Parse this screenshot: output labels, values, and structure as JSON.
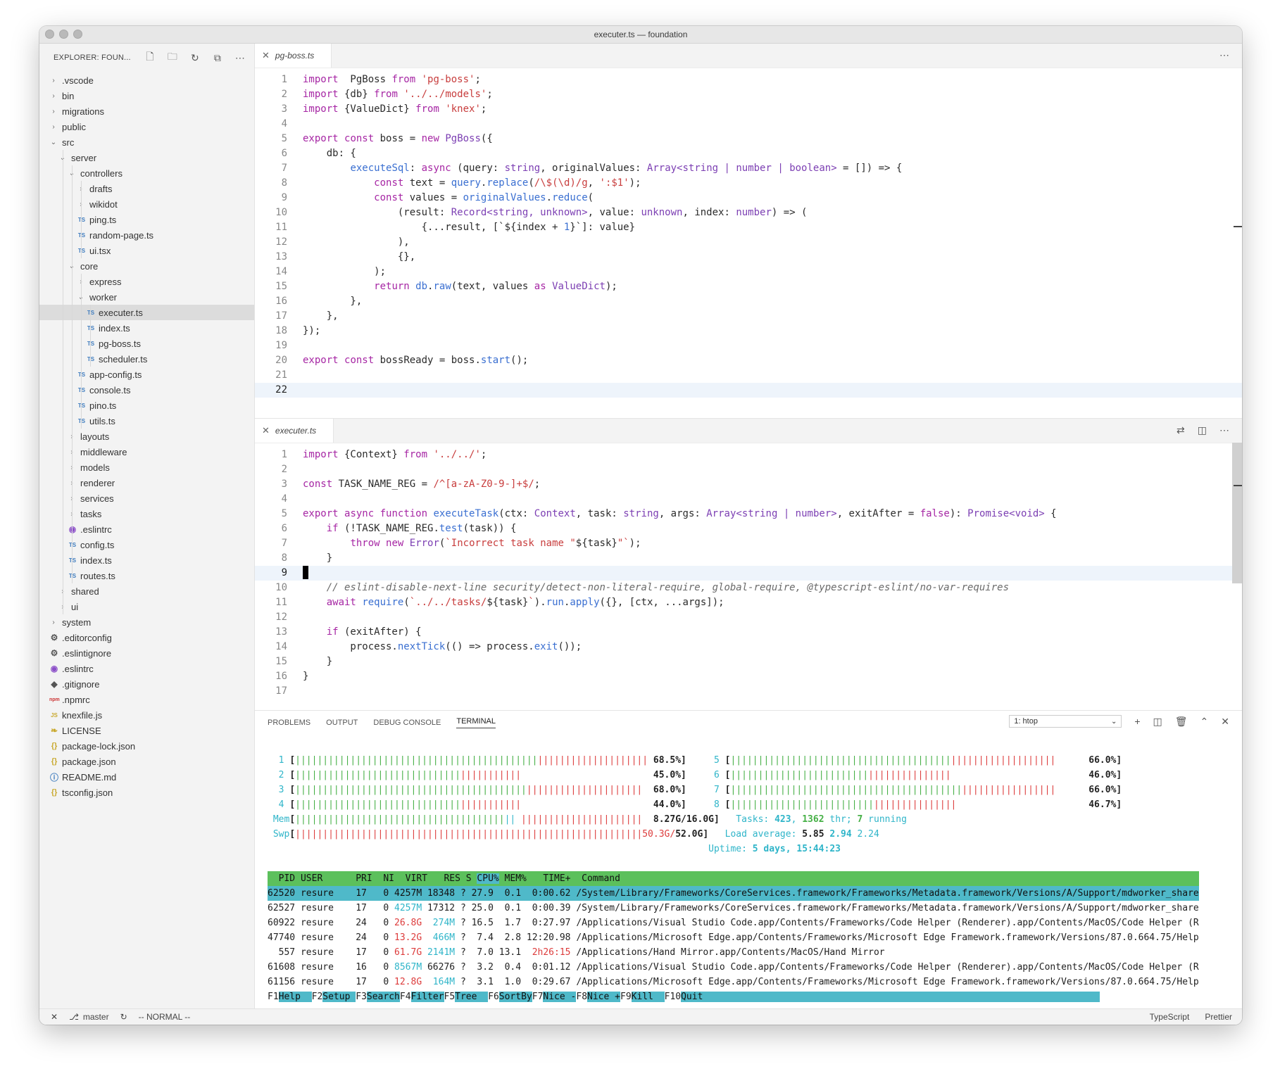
{
  "window": {
    "title": "executer.ts — foundation"
  },
  "sidebar": {
    "title": "EXPLORER: FOUN...",
    "actions": [
      "new-file-icon",
      "new-folder-icon",
      "refresh-icon",
      "collapse-icon",
      "more-icon"
    ],
    "tree": [
      {
        "d": 0,
        "t": "folder",
        "label": ".vscode",
        "open": false
      },
      {
        "d": 0,
        "t": "folder",
        "label": "bin",
        "open": false
      },
      {
        "d": 0,
        "t": "folder",
        "label": "migrations",
        "open": false
      },
      {
        "d": 0,
        "t": "folder",
        "label": "public",
        "open": false
      },
      {
        "d": 0,
        "t": "folder",
        "label": "src",
        "open": true
      },
      {
        "d": 1,
        "t": "folder",
        "label": "server",
        "open": true
      },
      {
        "d": 2,
        "t": "folder",
        "label": "controllers",
        "open": true
      },
      {
        "d": 3,
        "t": "folder",
        "label": "drafts",
        "open": false
      },
      {
        "d": 3,
        "t": "folder",
        "label": "wikidot",
        "open": false
      },
      {
        "d": 3,
        "t": "ts",
        "label": "ping.ts"
      },
      {
        "d": 3,
        "t": "ts",
        "label": "random-page.ts"
      },
      {
        "d": 3,
        "t": "ts",
        "label": "ui.tsx"
      },
      {
        "d": 2,
        "t": "folder",
        "label": "core",
        "open": true
      },
      {
        "d": 3,
        "t": "folder",
        "label": "express",
        "open": false
      },
      {
        "d": 3,
        "t": "folder",
        "label": "worker",
        "open": true
      },
      {
        "d": 4,
        "t": "ts",
        "label": "executer.ts",
        "selected": true
      },
      {
        "d": 4,
        "t": "ts",
        "label": "index.ts"
      },
      {
        "d": 4,
        "t": "ts",
        "label": "pg-boss.ts"
      },
      {
        "d": 4,
        "t": "ts",
        "label": "scheduler.ts"
      },
      {
        "d": 3,
        "t": "ts",
        "label": "app-config.ts"
      },
      {
        "d": 3,
        "t": "ts",
        "label": "console.ts"
      },
      {
        "d": 3,
        "t": "ts",
        "label": "pino.ts"
      },
      {
        "d": 3,
        "t": "ts",
        "label": "utils.ts"
      },
      {
        "d": 2,
        "t": "folder",
        "label": "layouts",
        "open": false
      },
      {
        "d": 2,
        "t": "folder",
        "label": "middleware",
        "open": false
      },
      {
        "d": 2,
        "t": "folder",
        "label": "models",
        "open": false
      },
      {
        "d": 2,
        "t": "folder",
        "label": "renderer",
        "open": false
      },
      {
        "d": 2,
        "t": "folder",
        "label": "services",
        "open": false
      },
      {
        "d": 2,
        "t": "folder",
        "label": "tasks",
        "open": false
      },
      {
        "d": 2,
        "t": "eslint",
        "label": ".eslintrc"
      },
      {
        "d": 2,
        "t": "ts",
        "label": "config.ts"
      },
      {
        "d": 2,
        "t": "ts",
        "label": "index.ts"
      },
      {
        "d": 2,
        "t": "ts",
        "label": "routes.ts"
      },
      {
        "d": 1,
        "t": "folder",
        "label": "shared",
        "open": false
      },
      {
        "d": 1,
        "t": "folder",
        "label": "ui",
        "open": false
      },
      {
        "d": 0,
        "t": "folder",
        "label": "system",
        "open": false
      },
      {
        "d": 0,
        "t": "gear",
        "label": ".editorconfig"
      },
      {
        "d": 0,
        "t": "gear",
        "label": ".eslintignore"
      },
      {
        "d": 0,
        "t": "eslint",
        "label": ".eslintrc"
      },
      {
        "d": 0,
        "t": "git",
        "label": ".gitignore"
      },
      {
        "d": 0,
        "t": "npm",
        "label": ".npmrc"
      },
      {
        "d": 0,
        "t": "js",
        "label": "knexfile.js"
      },
      {
        "d": 0,
        "t": "license",
        "label": "LICENSE"
      },
      {
        "d": 0,
        "t": "json",
        "label": "package-lock.json"
      },
      {
        "d": 0,
        "t": "json",
        "label": "package.json"
      },
      {
        "d": 0,
        "t": "info",
        "label": "README.md"
      },
      {
        "d": 0,
        "t": "json",
        "label": "tsconfig.json"
      }
    ]
  },
  "editor_top": {
    "tab": "pg-boss.ts",
    "current_line": 22,
    "lines": [
      [
        [
          "kw",
          "import"
        ],
        [
          "",
          "  PgBoss "
        ],
        [
          "kw",
          "from"
        ],
        [
          "",
          " "
        ],
        [
          "str",
          "'pg-boss'"
        ],
        [
          "",
          ";"
        ]
      ],
      [
        [
          "kw",
          "import"
        ],
        [
          "",
          " {db} "
        ],
        [
          "kw",
          "from"
        ],
        [
          "",
          " "
        ],
        [
          "str",
          "'../../models'"
        ],
        [
          "",
          ";"
        ]
      ],
      [
        [
          "kw",
          "import"
        ],
        [
          "",
          " {ValueDict} "
        ],
        [
          "kw",
          "from"
        ],
        [
          "",
          " "
        ],
        [
          "str",
          "'knex'"
        ],
        [
          "",
          ";"
        ]
      ],
      [],
      [
        [
          "kw",
          "export"
        ],
        [
          "",
          " "
        ],
        [
          "kw",
          "const"
        ],
        [
          "",
          " boss = "
        ],
        [
          "kw",
          "new"
        ],
        [
          "",
          " "
        ],
        [
          "ty",
          "PgBoss"
        ],
        [
          "",
          "({"
        ]
      ],
      [
        [
          "",
          "    db: {"
        ]
      ],
      [
        [
          "",
          "        "
        ],
        [
          "fn",
          "executeSql"
        ],
        [
          "",
          ": "
        ],
        [
          "kw",
          "async"
        ],
        [
          "",
          " (query: "
        ],
        [
          "ty",
          "string"
        ],
        [
          "",
          ", originalValues: "
        ],
        [
          "ty",
          "Array<string | number | boolean>"
        ],
        [
          "",
          " = []) => {"
        ]
      ],
      [
        [
          "",
          "            "
        ],
        [
          "kw",
          "const"
        ],
        [
          "",
          " text = "
        ],
        [
          "fn",
          "query"
        ],
        [
          "",
          "."
        ],
        [
          "fn",
          "replace"
        ],
        [
          "",
          "("
        ],
        [
          "str",
          "/\\$(\\d)/g"
        ],
        [
          "",
          ", "
        ],
        [
          "str",
          "':$1'"
        ],
        [
          "",
          ");"
        ]
      ],
      [
        [
          "",
          "            "
        ],
        [
          "kw",
          "const"
        ],
        [
          "",
          " values = "
        ],
        [
          "fn",
          "originalValues"
        ],
        [
          "",
          "."
        ],
        [
          "fn",
          "reduce"
        ],
        [
          "",
          "("
        ]
      ],
      [
        [
          "",
          "                (result: "
        ],
        [
          "ty",
          "Record<string, unknown>"
        ],
        [
          "",
          ", value: "
        ],
        [
          "ty",
          "unknown"
        ],
        [
          "",
          ", index: "
        ],
        [
          "ty",
          "number"
        ],
        [
          "",
          ") => ("
        ]
      ],
      [
        [
          "",
          "                    {...result, [`${index + "
        ],
        [
          "num",
          "1"
        ],
        [
          "",
          "}`]: value}"
        ]
      ],
      [
        [
          "",
          "                ),"
        ]
      ],
      [
        [
          "",
          "                {},"
        ]
      ],
      [
        [
          "",
          "            );"
        ]
      ],
      [
        [
          "",
          "            "
        ],
        [
          "kw",
          "return"
        ],
        [
          "",
          " "
        ],
        [
          "fn",
          "db"
        ],
        [
          "",
          "."
        ],
        [
          "fn",
          "raw"
        ],
        [
          "",
          "(text, values "
        ],
        [
          "kw",
          "as"
        ],
        [
          "",
          " "
        ],
        [
          "ty",
          "ValueDict"
        ],
        [
          "",
          ");"
        ]
      ],
      [
        [
          "",
          "        },"
        ]
      ],
      [
        [
          "",
          "    },"
        ]
      ],
      [
        [
          "",
          "});"
        ]
      ],
      [],
      [
        [
          "kw",
          "export"
        ],
        [
          "",
          " "
        ],
        [
          "kw",
          "const"
        ],
        [
          "",
          " bossReady = boss."
        ],
        [
          "fn",
          "start"
        ],
        [
          "",
          "();"
        ]
      ],
      [],
      []
    ]
  },
  "editor_bottom": {
    "tab": "executer.ts",
    "current_line": 9,
    "lines": [
      [
        [
          "kw",
          "import"
        ],
        [
          "",
          " {Context} "
        ],
        [
          "kw",
          "from"
        ],
        [
          "",
          " "
        ],
        [
          "str",
          "'../../'"
        ],
        [
          "",
          ";"
        ]
      ],
      [],
      [
        [
          "kw",
          "const"
        ],
        [
          "",
          " TASK_NAME_REG = "
        ],
        [
          "str",
          "/^[a-zA-Z0-9-]+$/"
        ],
        [
          "",
          ";"
        ]
      ],
      [],
      [
        [
          "kw",
          "export"
        ],
        [
          "",
          " "
        ],
        [
          "kw",
          "async"
        ],
        [
          "",
          " "
        ],
        [
          "kw",
          "function"
        ],
        [
          "",
          " "
        ],
        [
          "fn",
          "executeTask"
        ],
        [
          "",
          "(ctx: "
        ],
        [
          "ty",
          "Context"
        ],
        [
          "",
          ", task: "
        ],
        [
          "ty",
          "string"
        ],
        [
          "",
          ", args: "
        ],
        [
          "ty",
          "Array<string | number>"
        ],
        [
          "",
          ", exitAfter = "
        ],
        [
          "kw",
          "false"
        ],
        [
          "",
          "): "
        ],
        [
          "ty",
          "Promise<void>"
        ],
        [
          "",
          " {"
        ]
      ],
      [
        [
          "",
          "    "
        ],
        [
          "kw",
          "if"
        ],
        [
          "",
          " (!TASK_NAME_REG."
        ],
        [
          "fn",
          "test"
        ],
        [
          "",
          "(task)) {"
        ]
      ],
      [
        [
          "",
          "        "
        ],
        [
          "kw",
          "throw"
        ],
        [
          "",
          " "
        ],
        [
          "kw",
          "new"
        ],
        [
          "",
          " "
        ],
        [
          "ty",
          "Error"
        ],
        [
          "",
          "("
        ],
        [
          "str",
          "`Incorrect task name \""
        ],
        [
          "",
          "${task}"
        ],
        [
          "str",
          "\"`"
        ],
        [
          "",
          ");"
        ]
      ],
      [
        [
          "",
          "    }"
        ]
      ],
      [],
      [
        [
          "",
          "    "
        ],
        [
          "cm",
          "// eslint-disable-next-line security/detect-non-literal-require, global-require, @typescript-eslint/no-var-requires"
        ]
      ],
      [
        [
          "",
          "    "
        ],
        [
          "kw",
          "await"
        ],
        [
          "",
          " "
        ],
        [
          "fn",
          "require"
        ],
        [
          "",
          "("
        ],
        [
          "str",
          "`../../tasks/"
        ],
        [
          "",
          "${task}"
        ],
        [
          "str",
          "`"
        ],
        [
          "",
          ")."
        ],
        [
          "fn",
          "run"
        ],
        [
          "",
          "."
        ],
        [
          "fn",
          "apply"
        ],
        [
          "",
          "({}, [ctx, ...args]);"
        ]
      ],
      [],
      [
        [
          "",
          "    "
        ],
        [
          "kw",
          "if"
        ],
        [
          "",
          " (exitAfter) {"
        ]
      ],
      [
        [
          "",
          "        process."
        ],
        [
          "fn",
          "nextTick"
        ],
        [
          "",
          "(() => process."
        ],
        [
          "fn",
          "exit"
        ],
        [
          "",
          "());"
        ]
      ],
      [
        [
          "",
          "    }"
        ]
      ],
      [
        [
          "",
          "}"
        ]
      ],
      []
    ]
  },
  "panel": {
    "tabs": [
      "PROBLEMS",
      "OUTPUT",
      "DEBUG CONSOLE",
      "TERMINAL"
    ],
    "active_tab": "TERMINAL",
    "terminal_select": "1: htop",
    "actions": [
      "add-terminal-icon",
      "split-terminal-icon",
      "trash-icon",
      "maximize-icon",
      "close-icon"
    ]
  },
  "htop": {
    "cpus": [
      {
        "id": "1",
        "green": 44,
        "red": 20,
        "pct": "68.5%"
      },
      {
        "id": "2",
        "green": 30,
        "red": 11,
        "pct": "45.0%"
      },
      {
        "id": "3",
        "green": 42,
        "red": 21,
        "pct": "68.0%"
      },
      {
        "id": "4",
        "green": 30,
        "red": 11,
        "pct": "44.0%"
      },
      {
        "id": "5",
        "green": 40,
        "red": 19,
        "pct": "66.0%"
      },
      {
        "id": "6",
        "green": 25,
        "red": 15,
        "pct": "46.0%"
      },
      {
        "id": "7",
        "green": 42,
        "red": 17,
        "pct": "66.0%"
      },
      {
        "id": "8",
        "green": 26,
        "red": 15,
        "pct": "46.7%"
      }
    ],
    "mem": {
      "label": "Mem",
      "value": "8.27G/16.0G"
    },
    "swp": {
      "label": "Swp",
      "value": "50.3G/52.0G"
    },
    "tasks": {
      "count": "423",
      "thr": "1362",
      "running": "7"
    },
    "load": {
      "a": "5.85",
      "b": "2.94",
      "c": "2.24"
    },
    "uptime": "5 days, 15:44:23",
    "header": [
      "PID",
      "USER",
      "PRI",
      "NI",
      "VIRT",
      "RES",
      "S",
      "CPU%",
      "MEM%",
      "TIME+",
      "Command"
    ],
    "processes": [
      {
        "pid": "62520",
        "user": "resure",
        "pri": "17",
        "ni": "0",
        "virt": "4257M",
        "res": "18348",
        "s": "?",
        "cpu": "27.9",
        "mem": "0.1",
        "time": "0:00.62",
        "cmd": "/System/Library/Frameworks/CoreServices.framework/Frameworks/Metadata.framework/Versions/A/Support/mdworker_share",
        "selected": true
      },
      {
        "pid": "62527",
        "user": "resure",
        "pri": "17",
        "ni": "0",
        "virt": "4257M",
        "res": "17312",
        "s": "?",
        "cpu": "25.0",
        "mem": "0.1",
        "time": "0:00.39",
        "cmd": "/System/Library/Frameworks/CoreServices.framework/Frameworks/Metadata.framework/Versions/A/Support/mdworker_share"
      },
      {
        "pid": "60922",
        "user": "resure",
        "pri": "24",
        "ni": "0",
        "virt": "26.8G",
        "res": "274M",
        "s": "?",
        "cpu": "16.5",
        "mem": "1.7",
        "time": "0:27.97",
        "cmd": "/Applications/Visual Studio Code.app/Contents/Frameworks/Code Helper (Renderer).app/Contents/MacOS/Code Helper (R"
      },
      {
        "pid": "47740",
        "user": "resure",
        "pri": "24",
        "ni": "0",
        "virt": "13.2G",
        "res": "466M",
        "s": "?",
        "cpu": "7.4",
        "mem": "2.8",
        "time": "12:20.98",
        "cmd": "/Applications/Microsoft Edge.app/Contents/Frameworks/Microsoft Edge Framework.framework/Versions/87.0.664.75/Help"
      },
      {
        "pid": "557",
        "user": "resure",
        "pri": "17",
        "ni": "0",
        "virt": "61.7G",
        "res": "2141M",
        "s": "?",
        "cpu": "7.0",
        "mem": "13.1",
        "time": "2h26:15",
        "cmd": "/Applications/Hand Mirror.app/Contents/MacOS/Hand Mirror"
      },
      {
        "pid": "61608",
        "user": "resure",
        "pri": "16",
        "ni": "0",
        "virt": "8567M",
        "res": "66276",
        "s": "?",
        "cpu": "3.2",
        "mem": "0.4",
        "time": "0:01.12",
        "cmd": "/Applications/Visual Studio Code.app/Contents/Frameworks/Code Helper (Renderer).app/Contents/MacOS/Code Helper (R"
      },
      {
        "pid": "61156",
        "user": "resure",
        "pri": "17",
        "ni": "0",
        "virt": "12.8G",
        "res": "164M",
        "s": "?",
        "cpu": "3.1",
        "mem": "1.0",
        "time": "0:29.67",
        "cmd": "/Applications/Microsoft Edge.app/Contents/Frameworks/Microsoft Edge Framework.framework/Versions/87.0.664.75/Help"
      }
    ],
    "fkeys": [
      [
        "F1",
        "Help"
      ],
      [
        "F2",
        "Setup"
      ],
      [
        "F3",
        "Search"
      ],
      [
        "F4",
        "Filter"
      ],
      [
        "F5",
        "Tree"
      ],
      [
        "F6",
        "SortBy"
      ],
      [
        "F7",
        "Nice -"
      ],
      [
        "F8",
        "Nice +"
      ],
      [
        "F9",
        "Kill"
      ],
      [
        "F10",
        "Quit"
      ]
    ]
  },
  "status": {
    "branch": "master",
    "mode": "-- NORMAL --",
    "language": "TypeScript",
    "formatter": "Prettier"
  }
}
